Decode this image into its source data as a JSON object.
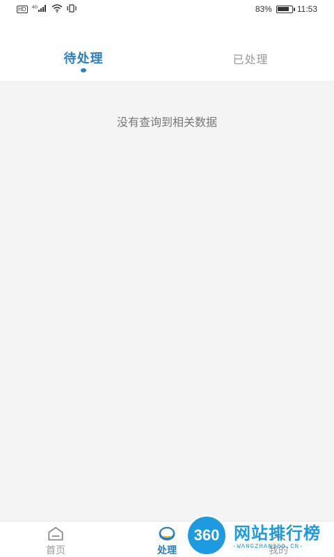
{
  "status_bar": {
    "left_text": "HD",
    "signal_label": "4G",
    "battery_percent": "83%",
    "battery_level": 0.83,
    "time": "11:53"
  },
  "tabs": [
    {
      "label": "待处理",
      "active": true
    },
    {
      "label": "已处理",
      "active": false
    }
  ],
  "content": {
    "empty_message": "没有查询到相关数据"
  },
  "bottom_nav": {
    "items": [
      {
        "label": "首页",
        "icon": "home-icon",
        "active": false
      },
      {
        "label": "处理",
        "icon": "process-icon",
        "active": true
      },
      {
        "label": "我的",
        "icon": "profile-icon",
        "active": false
      }
    ]
  },
  "watermark": {
    "logo_text": "360",
    "title": "网站排行榜",
    "subtitle": "-WANGZHAN360.CN-"
  },
  "colors": {
    "accent": "#2a7fc3",
    "background": "#f4f4f4",
    "watermark": "#1e9be0"
  }
}
